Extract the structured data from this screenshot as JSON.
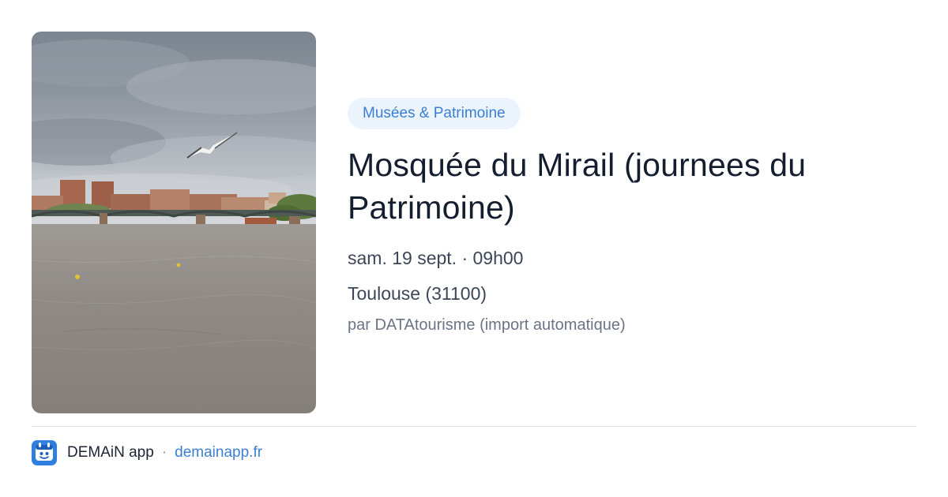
{
  "event": {
    "category": "Musées & Patrimoine",
    "title": "Mosquée du Mirail (journees du Patrimoine)",
    "datetime": "sam. 19 sept. · 09h00",
    "location": "Toulouse (31100)",
    "source": "par DATAtourisme (import automatique)"
  },
  "footer": {
    "app_name": "DEMAiN app",
    "separator": "·",
    "website": "demainapp.fr",
    "app_icon": "demain-app-icon"
  },
  "colors": {
    "accent": "#3b7fd4",
    "badge_bg": "#ebf3fc",
    "title": "#151e2f",
    "body_text": "#3c4658",
    "muted_text": "#6b7486"
  }
}
